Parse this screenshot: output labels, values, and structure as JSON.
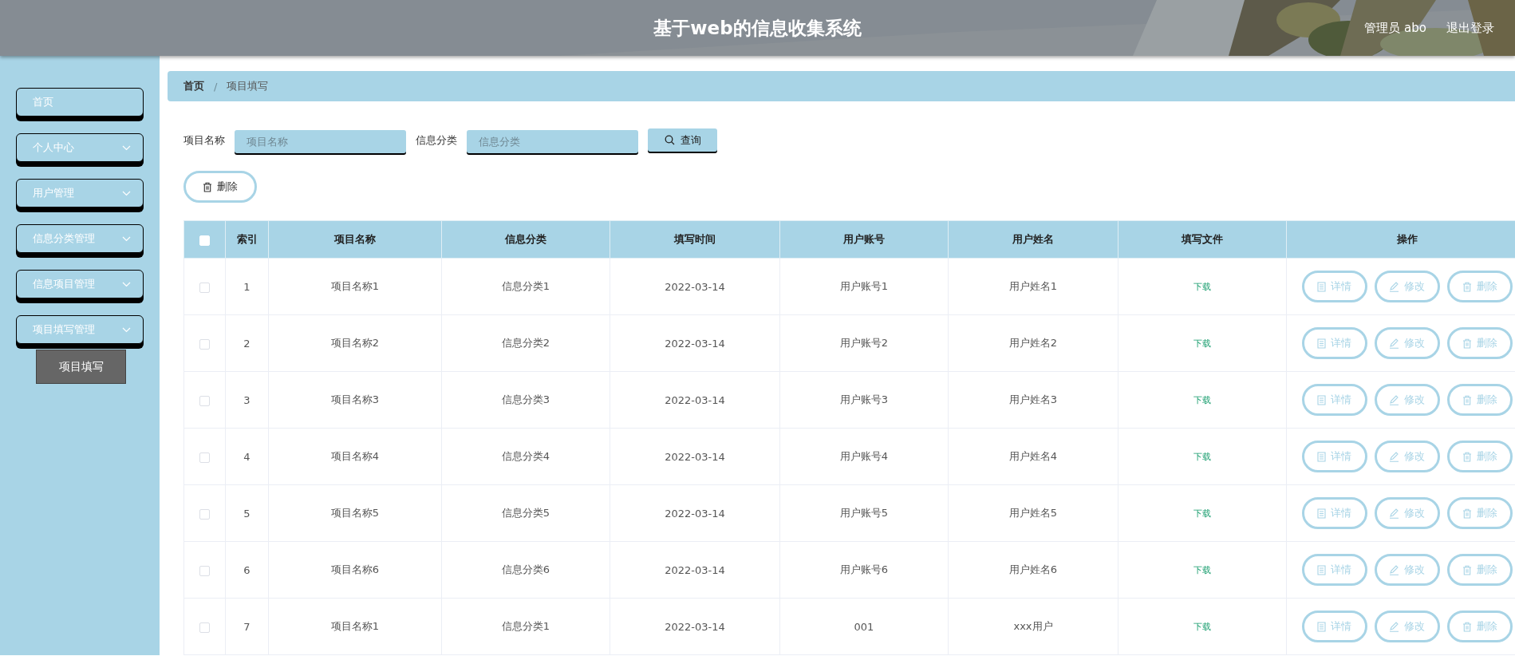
{
  "header": {
    "title": "基于web的信息收集系统",
    "user": "管理员 abo",
    "logout": "退出登录"
  },
  "sidebar": {
    "items": [
      {
        "label": "首页",
        "kind": "link"
      },
      {
        "label": "个人中心",
        "kind": "menu"
      },
      {
        "label": "用户管理",
        "kind": "menu"
      },
      {
        "label": "信息分类管理",
        "kind": "menu"
      },
      {
        "label": "信息项目管理",
        "kind": "menu"
      },
      {
        "label": "项目填写管理",
        "kind": "menu",
        "children": [
          {
            "label": "项目填写"
          }
        ]
      }
    ]
  },
  "breadcrumb": {
    "separator": "/",
    "items": [
      "首页",
      "项目填写"
    ]
  },
  "search": {
    "fields": [
      {
        "label": "项目名称",
        "placeholder": "项目名称"
      },
      {
        "label": "信息分类",
        "placeholder": "信息分类"
      }
    ],
    "button": "查询"
  },
  "toolbar": {
    "delete_button": "删除"
  },
  "table": {
    "select_all": {
      "checked": false
    },
    "columns": [
      "索引",
      "项目名称",
      "信息分类",
      "填写时间",
      "用户账号",
      "用户姓名",
      "填写文件",
      "操作"
    ],
    "rows": [
      {
        "checked": false,
        "cells": [
          "1",
          "项目名称1",
          "信息分类1",
          "2022-03-14",
          "用户账号1",
          "用户姓名1"
        ],
        "file": "下载",
        "actions": [
          "详情",
          "修改",
          "删除"
        ]
      },
      {
        "checked": false,
        "cells": [
          "2",
          "项目名称2",
          "信息分类2",
          "2022-03-14",
          "用户账号2",
          "用户姓名2"
        ],
        "file": "下载",
        "actions": [
          "详情",
          "修改",
          "删除"
        ]
      },
      {
        "checked": false,
        "cells": [
          "3",
          "项目名称3",
          "信息分类3",
          "2022-03-14",
          "用户账号3",
          "用户姓名3"
        ],
        "file": "下载",
        "actions": [
          "详情",
          "修改",
          "删除"
        ]
      },
      {
        "checked": false,
        "cells": [
          "4",
          "项目名称4",
          "信息分类4",
          "2022-03-14",
          "用户账号4",
          "用户姓名4"
        ],
        "file": "下载",
        "actions": [
          "详情",
          "修改",
          "删除"
        ]
      },
      {
        "checked": false,
        "cells": [
          "5",
          "项目名称5",
          "信息分类5",
          "2022-03-14",
          "用户账号5",
          "用户姓名5"
        ],
        "file": "下载",
        "actions": [
          "详情",
          "修改",
          "删除"
        ]
      },
      {
        "checked": false,
        "cells": [
          "6",
          "项目名称6",
          "信息分类6",
          "2022-03-14",
          "用户账号6",
          "用户姓名6"
        ],
        "file": "下载",
        "actions": [
          "详情",
          "修改",
          "删除"
        ]
      },
      {
        "checked": false,
        "cells": [
          "7",
          "项目名称1",
          "信息分类1",
          "2022-03-14",
          "001",
          "xxx用户"
        ],
        "file": "下载",
        "actions": [
          "详情",
          "修改",
          "删除"
        ]
      }
    ]
  }
}
